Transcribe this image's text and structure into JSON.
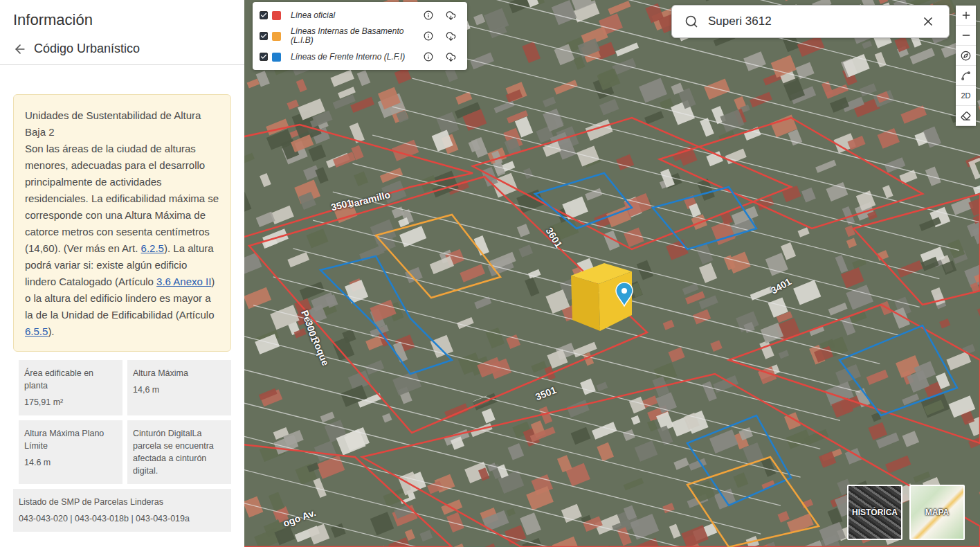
{
  "panel": {
    "title": "Información",
    "section": "Código Urbanístico"
  },
  "info_card": {
    "title": "Unidades de Sustentabilidad de Altura Baja 2",
    "segments": [
      {
        "text": "Son las áreas de la ciudad de alturas menores, adecuadas para el desarrollo principalmente de actividades residenciales. La edificabilidad máxima se corresponde con una Altura Máxima de catorce metros con sesenta centímetros (14,60). (Ver más en Art. ",
        "link": false
      },
      {
        "text": "6.2.5",
        "link": true
      },
      {
        "text": "). La altura podrá variar si: existe algún edificio lindero Catalogado (Artículo ",
        "link": false
      },
      {
        "text": "3.6 Anexo II",
        "link": true
      },
      {
        "text": ") o la altura del edificio lindero es mayor a la de la Unidad de Edificabilidad (Artículo ",
        "link": false
      },
      {
        "text": "6.5.5",
        "link": true
      },
      {
        "text": ").",
        "link": false
      }
    ]
  },
  "cells": [
    {
      "kind": "stacked",
      "label": "Área edificable en planta",
      "value": "175,91 m²"
    },
    {
      "kind": "stacked",
      "label": "Altura Máxima",
      "value": "14,6 m"
    },
    {
      "kind": "stacked",
      "label": "Altura Máxima Plano Límite",
      "value": "14.6 m"
    },
    {
      "kind": "inline",
      "label": "Cinturón Digital",
      "value": "La parcela se encuentra afectada a cinturón digital."
    },
    {
      "kind": "wide",
      "label": "Listado de SMP de Parcelas Linderas",
      "value": "043-043-020 | 043-043-018b | 043-043-019a"
    }
  ],
  "layers": [
    {
      "label": "Línea oficial",
      "checked": true,
      "color": "#e2463f"
    },
    {
      "label": "Líneas Internas de Basamento (L.I.B)",
      "checked": true,
      "color": "#f2a33a"
    },
    {
      "label": "Líneas de Frente Interno (L.F.I)",
      "checked": true,
      "color": "#1f7fcf"
    }
  ],
  "search": {
    "value": "Superi 3612"
  },
  "view_mode": "2D",
  "basemaps": [
    {
      "label": "HISTÓRICA"
    },
    {
      "label": "MAPA"
    }
  ],
  "map_labels": [
    "Jaramillo",
    "3501",
    "Perez Roque",
    "3001",
    "3501",
    "3401",
    "3601",
    "ogo Av."
  ]
}
